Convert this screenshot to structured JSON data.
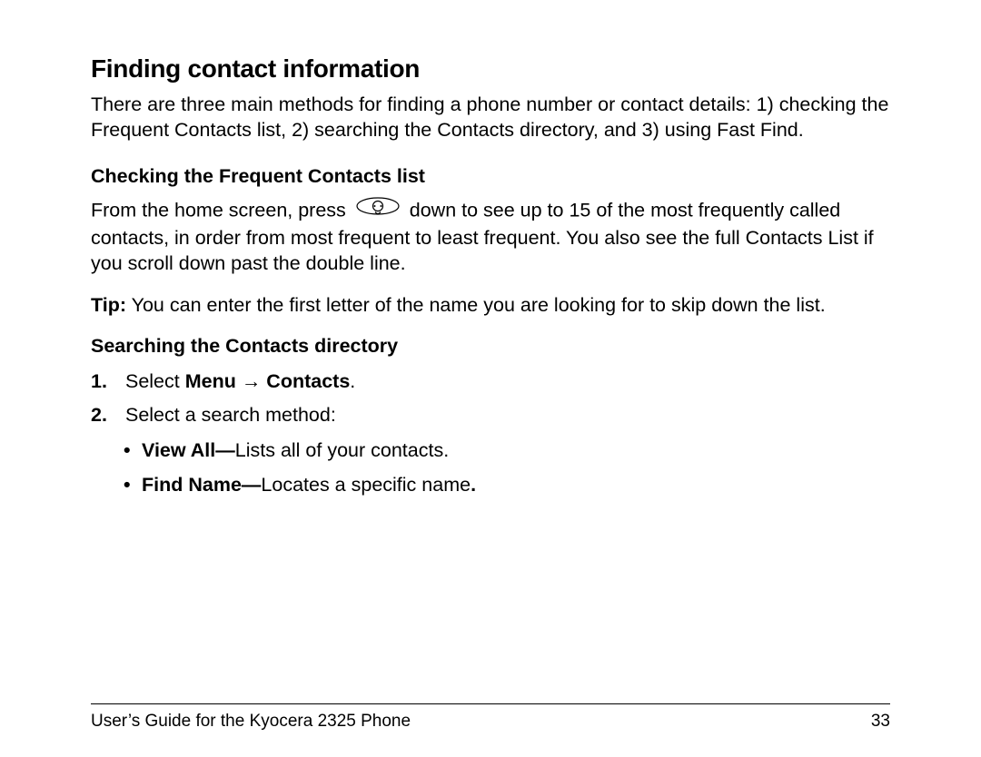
{
  "title": "Finding contact information",
  "intro": "There are three main methods for finding a phone number or contact details: 1) checking the Frequent Contacts list, 2) searching the Contacts directory, and 3) using Fast Find.",
  "section1": {
    "heading": "Checking the Frequent Contacts list",
    "p1_a": "From the home screen, press ",
    "p1_b": " down to see up to 15 of the most frequently called contacts, in order from most frequent to least frequent. You also see the full Contacts List if you scroll down past the double line.",
    "tip_label": "Tip:",
    "tip_text": " You can enter the first letter of the name you are looking for to skip down the list."
  },
  "section2": {
    "heading": "Searching the Contacts directory",
    "step1_num": "1.",
    "step1_a": " Select ",
    "step1_b": "Menu",
    "step1_arrow": " → ",
    "step1_c": "Contacts",
    "step1_d": ".",
    "step2_num": "2.",
    "step2_text": " Select a search method:",
    "bullet1_bold": "View All—",
    "bullet1_text": "Lists all of your contacts.",
    "bullet2_bold": "Find Name—",
    "bullet2_text": "Locates a specific name",
    "bullet2_punct": "."
  },
  "footer": {
    "left": "User’s Guide for the Kyocera 2325 Phone",
    "right": "33"
  }
}
